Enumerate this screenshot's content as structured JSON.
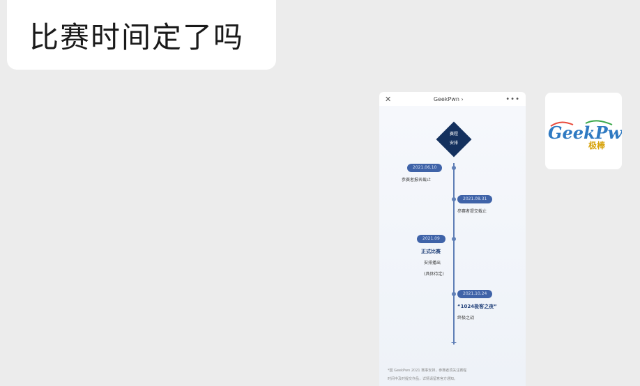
{
  "message": {
    "text": "比赛时间定了吗"
  },
  "shared_card": {
    "header": {
      "title": "GeekPwn",
      "more": "•••"
    },
    "diamond": {
      "line1": "赛程",
      "line2": "安排"
    },
    "timeline": [
      {
        "date": "2021.06.10",
        "desc": "参赛者报名截止"
      },
      {
        "date": "2021.08.31",
        "desc": "参赛者提交截止"
      },
      {
        "date": "2021.09",
        "bold": "正式比赛",
        "desc": "安排播出",
        "note": "(具体待定)"
      },
      {
        "date": "2021.10.24",
        "bold": "“1024极客之夜”",
        "desc": "终极之战"
      }
    ],
    "footer": {
      "line1": "*因 GeekPwn 2021 赛事安排，参赛者须关注赛程",
      "line2": "时间中及时提交作品，详情请留意官方通知。"
    }
  },
  "avatar": {
    "logo_text": "GeekPwn",
    "logo_sub": "极棒"
  },
  "colors": {
    "background": "#ececec",
    "bubble": "#ffffff",
    "navy": "#14315e",
    "timeline_blue": "#3f63a8"
  }
}
